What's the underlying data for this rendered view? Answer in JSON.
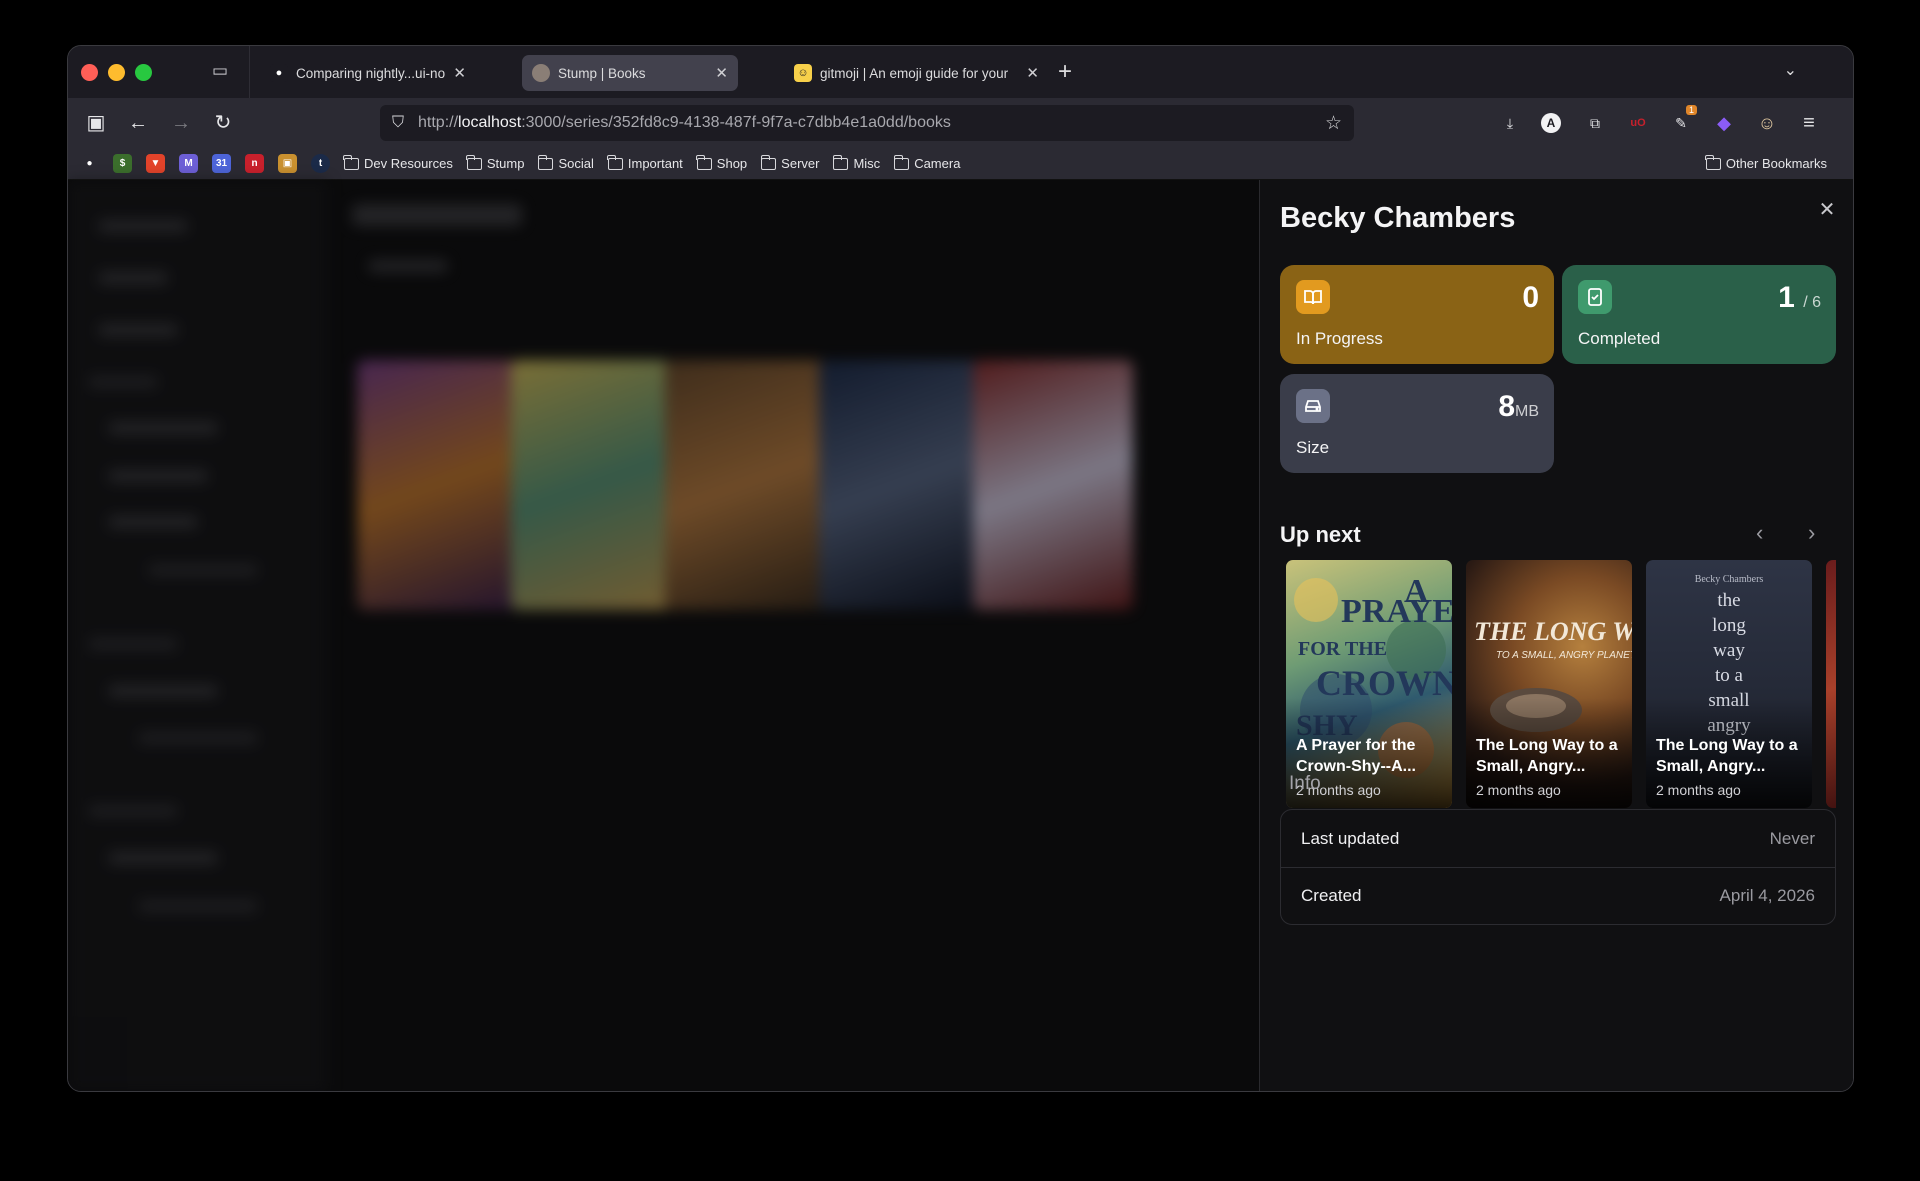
{
  "browser": {
    "tabs": [
      {
        "title": "Comparing nightly...ui-noodling",
        "favicon": "github-icon",
        "active": false
      },
      {
        "title": "Stump | Books",
        "favicon": "stump-icon",
        "active": true
      },
      {
        "title": "gitmoji | An emoji guide for your",
        "favicon": "gitmoji-icon",
        "active": false
      }
    ],
    "url": {
      "scheme": "http://",
      "host": "localhost",
      "path": ":3000/series/352fd8c9-4138-487f-9f7a-c7dbb4e1a0dd/books"
    },
    "extensions": [
      {
        "name": "download-icon",
        "glyph": "⤓"
      },
      {
        "name": "account-icon",
        "glyph": "A"
      },
      {
        "name": "extensions-icon",
        "glyph": "⧉"
      },
      {
        "name": "ublock-icon",
        "glyph": "uO"
      },
      {
        "name": "notification-ext-icon",
        "glyph": "✎",
        "badge": "1"
      },
      {
        "name": "diamond-ext-icon",
        "glyph": "◆"
      },
      {
        "name": "profile-ext-icon",
        "glyph": "☺"
      },
      {
        "name": "menu-icon",
        "glyph": "≡"
      }
    ],
    "bookmark_icons": [
      {
        "name": "github-bookmark-icon",
        "color": "#2b2a33",
        "glyph": "●"
      },
      {
        "name": "money-bookmark-icon",
        "color": "#3b6e2c",
        "glyph": "$"
      },
      {
        "name": "gitlab-bookmark-icon",
        "color": "#e2432a",
        "glyph": "▼"
      },
      {
        "name": "gmail-bookmark-icon",
        "color": "#6d5fd6",
        "glyph": "M"
      },
      {
        "name": "calendar-bookmark-icon",
        "color": "#4d64d8",
        "glyph": "31"
      },
      {
        "name": "red-bookmark-icon",
        "color": "#c8202c",
        "glyph": "n"
      },
      {
        "name": "package-bookmark-icon",
        "color": "#c9902f",
        "glyph": "▣"
      },
      {
        "name": "tumblr-bookmark-icon",
        "color": "#1b2a48",
        "glyph": "t"
      }
    ],
    "bookmark_folders": [
      "Dev Resources",
      "Stump",
      "Social",
      "Important",
      "Shop",
      "Server",
      "Misc",
      "Camera"
    ],
    "other_bookmarks": "Other Bookmarks"
  },
  "drawer": {
    "title": "Becky Chambers",
    "stats": {
      "in_progress": {
        "value": "0",
        "label": "In Progress",
        "color": "#8a6315"
      },
      "completed": {
        "value": "1",
        "total": "/ 6",
        "label": "Completed",
        "color": "#2a6049"
      },
      "size": {
        "value": "8",
        "unit": "MB",
        "label": "Size",
        "color": "#3a3d4a"
      }
    },
    "up_next": {
      "heading": "Up next",
      "books": [
        {
          "title": "A Prayer for the Crown-Shy--A...",
          "date": "2 months ago"
        },
        {
          "title": "The Long Way to a Small, Angry...",
          "date": "2 months ago"
        },
        {
          "title": "The Long Way to a Small, Angry...",
          "date": "2 months ago"
        }
      ]
    },
    "info": {
      "heading": "Info",
      "rows": [
        {
          "key": "Last updated",
          "value": "Never"
        },
        {
          "key": "Created",
          "value": "April 4, 2026"
        }
      ]
    }
  }
}
